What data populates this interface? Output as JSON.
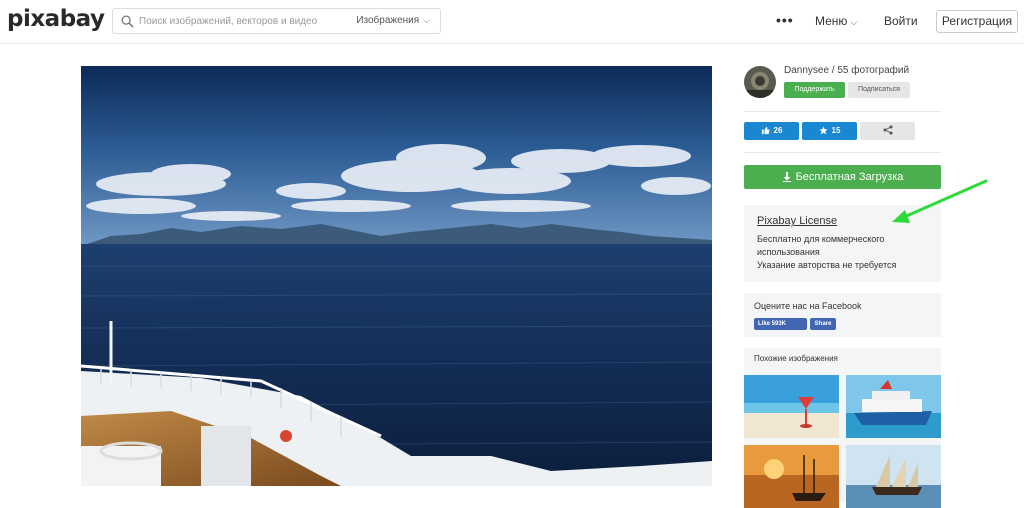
{
  "header": {
    "logo": "pixabay",
    "search_placeholder": "Поиск изображений, векторов и видео",
    "search_type": "Изображения",
    "more": "•••",
    "menu": "Меню",
    "login": "Войти",
    "register": "Регистрация"
  },
  "author": {
    "name_line": "Dannysee / 55 фотографий",
    "support": "Поддержать",
    "follow": "Подписаться"
  },
  "stats": {
    "likes": "26",
    "favorites": "15"
  },
  "download": {
    "label": "Бесплатная Загрузка"
  },
  "license": {
    "title": "Pixabay License",
    "lines": [
      "Бесплатно для коммерческого",
      "использования",
      "Указание авторства не требуется"
    ]
  },
  "facebook": {
    "title": "Оцените нас на Facebook",
    "like": "Like 593K",
    "share": "Share"
  },
  "similar": {
    "title": "Похожие изображения",
    "thumbs": [
      "beach-cocktail-thumb",
      "cruise-ship-thumb",
      "sunset-sailship-thumb",
      "sailing-ship-thumb"
    ]
  },
  "colors": {
    "accent_green": "#4bae4f",
    "accent_blue": "#1a87d2",
    "facebook_blue": "#4267b2",
    "annotation_arrow": "#2ed93a"
  }
}
